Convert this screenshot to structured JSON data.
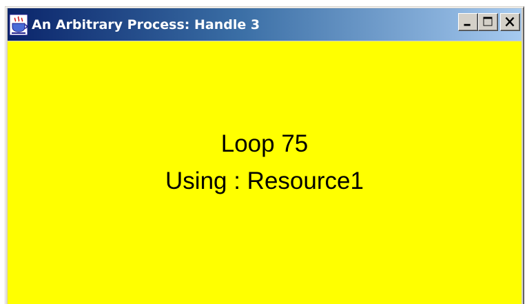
{
  "window": {
    "title": "An Arbitrary Process: Handle 3",
    "icon": "java-cup-icon",
    "buttons": [
      "minimize-icon",
      "maximize-icon",
      "close-icon"
    ]
  },
  "content": {
    "line1": "Loop 75",
    "line2": "Using : Resource1",
    "background_color": "#ffff00",
    "text_color": "#000000"
  },
  "colors": {
    "titlebar_start": "#0a246a",
    "titlebar_end": "#a6caf0",
    "frame": "#d4d0c8"
  }
}
